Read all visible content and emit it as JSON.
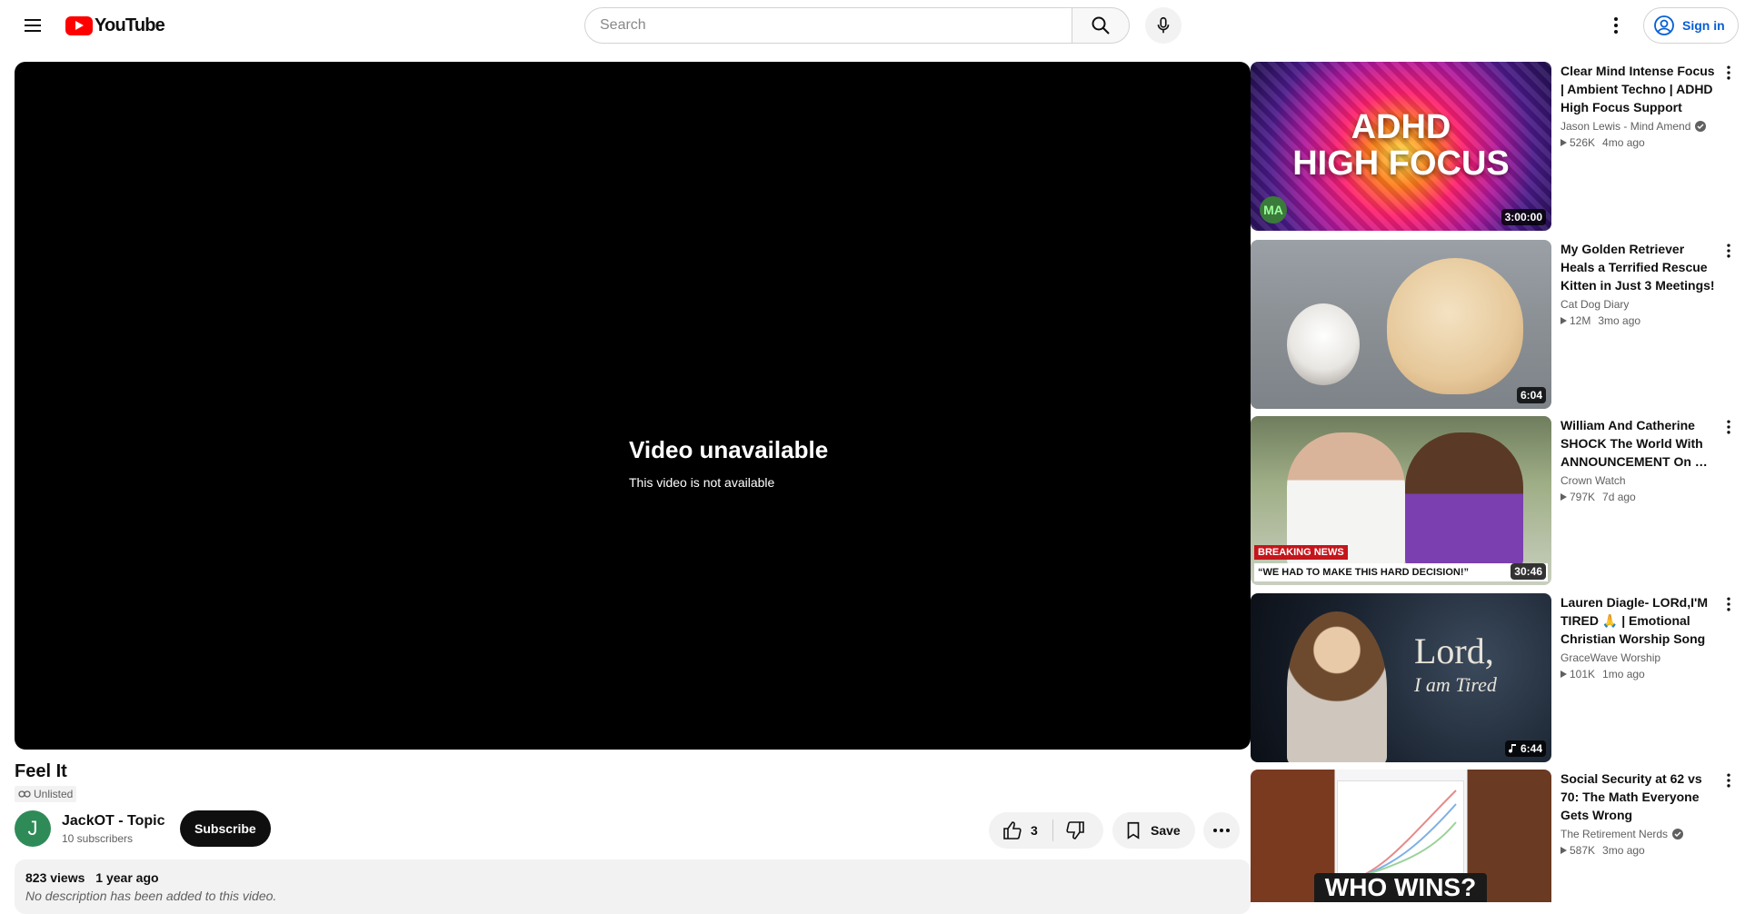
{
  "header": {
    "logo_text": "YouTube",
    "search_placeholder": "Search",
    "sign_in_label": "Sign in"
  },
  "player": {
    "message_title": "Video unavailable",
    "message_subtitle": "This video is not available"
  },
  "video": {
    "title": "Feel It",
    "privacy_badge": "Unlisted",
    "channel_name": "JackOT - Topic",
    "channel_initial": "J",
    "subscribers": "10 subscribers",
    "subscribe_label": "Subscribe",
    "like_count": "3",
    "save_label": "Save",
    "views": "823 views",
    "age": "1 year ago",
    "description": "No description has been added to this video."
  },
  "recommendations": [
    {
      "title": "Clear Mind Intense Focus | Ambient Techno | ADHD High Focus Support",
      "channel": "Jason Lewis - Mind Amend",
      "verified": true,
      "views": "526K",
      "age": "4mo ago",
      "duration": "3:00:00",
      "thumb_text_1": "ADHD",
      "thumb_text_2": "HIGH FOCUS",
      "thumb_badge": "MA"
    },
    {
      "title": "My Golden Retriever Heals a Terrified Rescue Kitten in Just 3 Meetings!",
      "channel": "Cat Dog Diary",
      "verified": false,
      "views": "12M",
      "age": "3mo ago",
      "duration": "6:04"
    },
    {
      "title": "William And Catherine SHOCK The World With ANNOUNCEMENT On …",
      "channel": "Crown Watch",
      "verified": false,
      "views": "797K",
      "age": "7d ago",
      "duration": "30:46",
      "thumb_tag": "BREAKING NEWS",
      "thumb_quote": "“WE HAD TO MAKE THIS HARD DECISION!”"
    },
    {
      "title": "Lauren Diagle- LORd,I'M TIRED 🙏 | Emotional Christian Worship Song …",
      "channel": "GraceWave Worship",
      "verified": false,
      "views": "101K",
      "age": "1mo ago",
      "duration": "6:44",
      "thumb_text_1": "Lord,",
      "thumb_text_2": "I am Tired"
    },
    {
      "title": "Social Security at 62 vs 70: The Math Everyone Gets Wrong",
      "channel": "The Retirement Nerds",
      "verified": true,
      "views": "587K",
      "age": "3mo ago",
      "duration": "",
      "thumb_text_1": "WHO WINS?"
    }
  ],
  "colors": {
    "brand_red": "#ff0000",
    "link_blue": "#065fd4",
    "text_primary": "#0f0f0f",
    "text_secondary": "#606060"
  }
}
